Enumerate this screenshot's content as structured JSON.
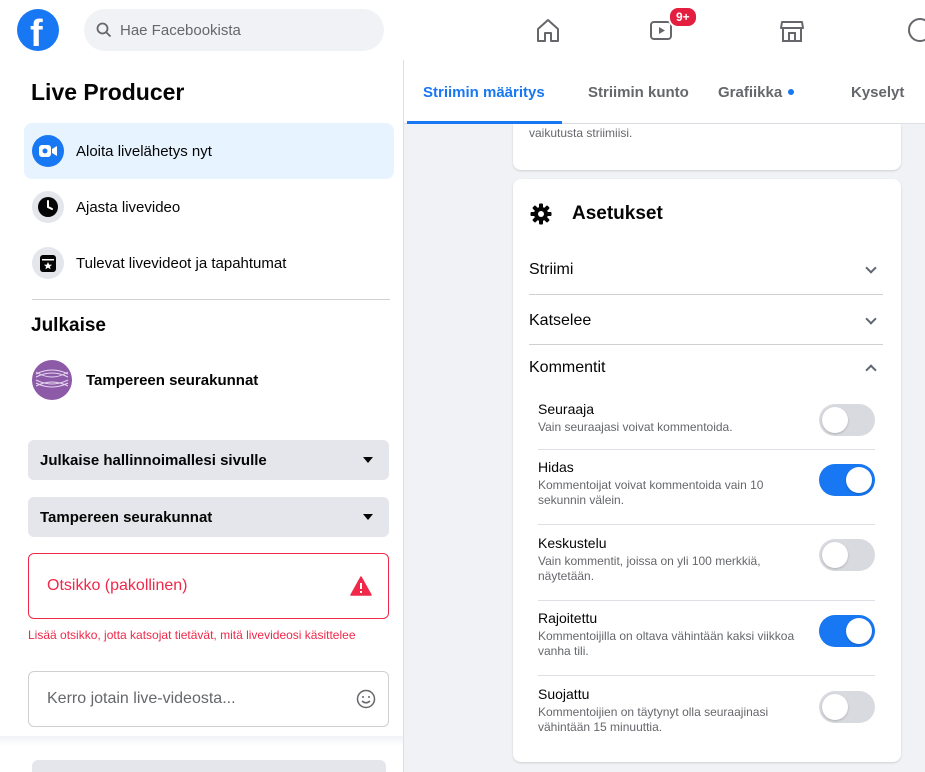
{
  "topbar": {
    "search_placeholder": "Hae Facebookista",
    "notification_badge": "9+"
  },
  "left": {
    "title": "Live Producer",
    "menu": [
      {
        "label": "Aloita livelähetys nyt",
        "icon": "live-camera-icon",
        "active": true
      },
      {
        "label": "Ajasta livevideo",
        "icon": "clock-icon",
        "active": false
      },
      {
        "label": "Tulevat livevideot ja tapahtumat",
        "icon": "calendar-star-icon",
        "active": false
      }
    ],
    "publish_title": "Julkaise",
    "page_name": "Tampereen seurakunnat",
    "dropdown_1": "Julkaise hallinnoimallesi sivulle",
    "dropdown_2": "Tampereen seurakunnat",
    "title_field_label": "Otsikko (pakollinen)",
    "title_error": "Lisää otsikko, jotta katsojat tietävät, mitä livevideosi käsittelee",
    "description_placeholder": "Kerro jotain live-videosta..."
  },
  "tabs": [
    {
      "label": "Striimin määritys",
      "active": true
    },
    {
      "label": "Striimin kunto",
      "active": false
    },
    {
      "label": "Grafiikka",
      "active": false,
      "dot": true
    },
    {
      "label": "Kyselyt",
      "active": false
    }
  ],
  "top_card_text": "vaikutusta striimiisi.",
  "settings": {
    "title": "Asetukset",
    "sections": [
      {
        "label": "Striimi",
        "expanded": false
      },
      {
        "label": "Katselee",
        "expanded": false
      },
      {
        "label": "Kommentit",
        "expanded": true
      }
    ],
    "comment_options": [
      {
        "title": "Seuraaja",
        "desc": "Vain seuraajasi voivat kommentoida.",
        "on": false
      },
      {
        "title": "Hidas",
        "desc": "Kommentoijat voivat kommentoida vain 10 sekunnin välein.",
        "on": true
      },
      {
        "title": "Keskustelu",
        "desc": "Vain kommentit, joissa on yli 100 merkkiä, näytetään.",
        "on": false
      },
      {
        "title": "Rajoitettu",
        "desc": "Kommentoijilla on oltava vähintään kaksi viikkoa vanha tili.",
        "on": true
      },
      {
        "title": "Suojattu",
        "desc": "Kommentoijien on täytynyt olla seuraajinasi vähintään 15 minuuttia.",
        "on": false
      }
    ]
  },
  "colors": {
    "accent": "#1877f2",
    "error": "#f02849"
  }
}
